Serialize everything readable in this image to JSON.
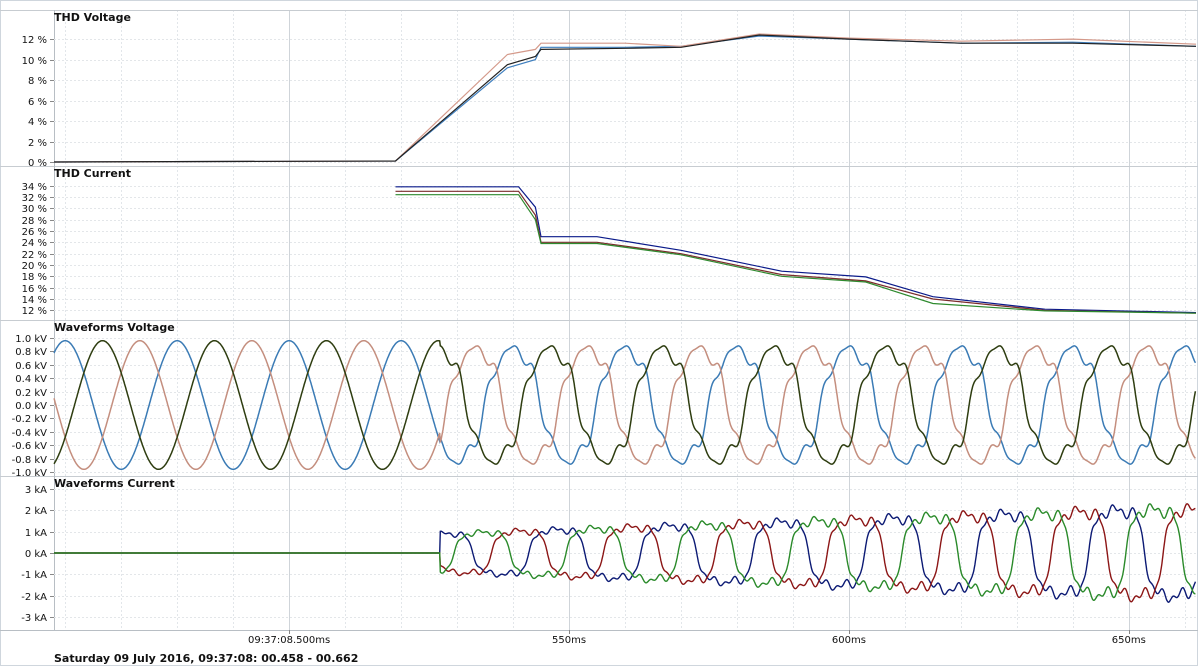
{
  "footer": "Saturday 09 July 2016, 09:37:08: 00.458 - 00.662",
  "x_axis": {
    "labels": [
      "09:37:08.500ms",
      "550ms",
      "600ms",
      "650ms"
    ],
    "label_values_ms": [
      500,
      550,
      600,
      650
    ]
  },
  "colors": {
    "thd_voltage": [
      "#3f7fbf",
      "#d4998a",
      "#222222"
    ],
    "thd_current": [
      "#0a1a8a",
      "#7a2c2c",
      "#2e8a2e"
    ],
    "wave_voltage": [
      "#3b7bb5",
      "#c48e7e",
      "#2e3d10"
    ],
    "wave_current": [
      "#0c1a74",
      "#8c1616",
      "#2a8a2a"
    ]
  },
  "chart_data": [
    {
      "type": "line",
      "title": "THD Voltage",
      "xlim": [
        458,
        662
      ],
      "ylim": [
        0,
        12.5
      ],
      "yticks": [
        0,
        2,
        4,
        6,
        8,
        10,
        12
      ],
      "ytick_labels": [
        "0 %",
        "2 %",
        "4 %",
        "6 %",
        "8 %",
        "10 %",
        "12 %"
      ],
      "series": [
        {
          "x": [
            458,
            519,
            539,
            544,
            545,
            560,
            570,
            584,
            600,
            620,
            640,
            662
          ],
          "y": [
            0,
            0.1,
            9.2,
            10.0,
            11.2,
            11.2,
            11.3,
            12.3,
            12.0,
            11.6,
            11.7,
            11.3
          ]
        },
        {
          "x": [
            458,
            519,
            539,
            544,
            545,
            560,
            570,
            584,
            600,
            620,
            640,
            662
          ],
          "y": [
            0,
            0.1,
            10.5,
            11.0,
            11.6,
            11.6,
            11.3,
            12.5,
            12.1,
            11.8,
            12.0,
            11.5
          ]
        },
        {
          "x": [
            458,
            519,
            539,
            544,
            545,
            560,
            570,
            584,
            600,
            620,
            640,
            662
          ],
          "y": [
            0,
            0.1,
            9.5,
            10.3,
            11.0,
            11.1,
            11.2,
            12.4,
            12.0,
            11.6,
            11.6,
            11.3
          ]
        }
      ]
    },
    {
      "type": "line",
      "title": "THD Current",
      "xlim": [
        458,
        662
      ],
      "ylim": [
        11,
        35
      ],
      "yticks": [
        12,
        14,
        16,
        18,
        20,
        22,
        24,
        26,
        28,
        30,
        32,
        34
      ],
      "ytick_labels": [
        "12 %",
        "14 %",
        "16 %",
        "18 %",
        "20 %",
        "22 %",
        "24 %",
        "26 %",
        "28 %",
        "30 %",
        "32 %",
        "34 %"
      ],
      "series": [
        {
          "x": [
            519,
            541,
            544,
            545,
            555,
            570,
            588,
            603,
            615,
            635,
            662
          ],
          "y": [
            33.8,
            33.8,
            30.2,
            25.0,
            25.0,
            22.6,
            18.9,
            17.9,
            14.4,
            12.2,
            11.6
          ]
        },
        {
          "x": [
            519,
            541,
            544,
            545,
            555,
            570,
            588,
            603,
            615,
            635,
            662
          ],
          "y": [
            33.0,
            33.0,
            28.8,
            24.0,
            24.0,
            22.0,
            18.3,
            17.2,
            14.0,
            12.0,
            11.5
          ]
        },
        {
          "x": [
            519,
            541,
            544,
            545,
            555,
            570,
            588,
            603,
            615,
            635,
            662
          ],
          "y": [
            32.4,
            32.4,
            28.0,
            23.8,
            23.8,
            21.8,
            18.0,
            17.0,
            13.2,
            11.9,
            11.5
          ]
        }
      ]
    },
    {
      "type": "line",
      "title": "Waveforms Voltage",
      "xlim": [
        458,
        662
      ],
      "ylim": [
        -1.0,
        1.0
      ],
      "yticks": [
        1.0,
        0.8,
        0.6,
        0.4,
        0.2,
        0.0,
        -0.2,
        -0.4,
        -0.6,
        -0.8,
        -1.0
      ],
      "ytick_labels": [
        "1.0 kV",
        "0.8 kV",
        "0.6 kV",
        "0.4 kV",
        "0.2 kV",
        "0.0 kV",
        "-0.2 kV",
        "-0.4 kV",
        "-0.6 kV",
        "-0.8 kV",
        "-1.0 kV"
      ],
      "wave": {
        "amplitude_kv": 0.96,
        "frequency_hz": 50,
        "distortion_start_ms": 527
      }
    },
    {
      "type": "line",
      "title": "Waveforms Current",
      "xlim": [
        458,
        662
      ],
      "ylim": [
        -3.4,
        3.4
      ],
      "yticks": [
        3,
        2,
        1,
        0,
        -1,
        -2,
        -3
      ],
      "ytick_labels": [
        "3 kA",
        "2 kA",
        "1 kA",
        "0 kA",
        "-1 kA",
        "-2 kA",
        "-3 kA"
      ],
      "wave": {
        "start_ms": 527,
        "amplitude_start_ka": 1.35,
        "amplitude_end_ka": 3.05,
        "frequency_hz": 50
      }
    }
  ]
}
